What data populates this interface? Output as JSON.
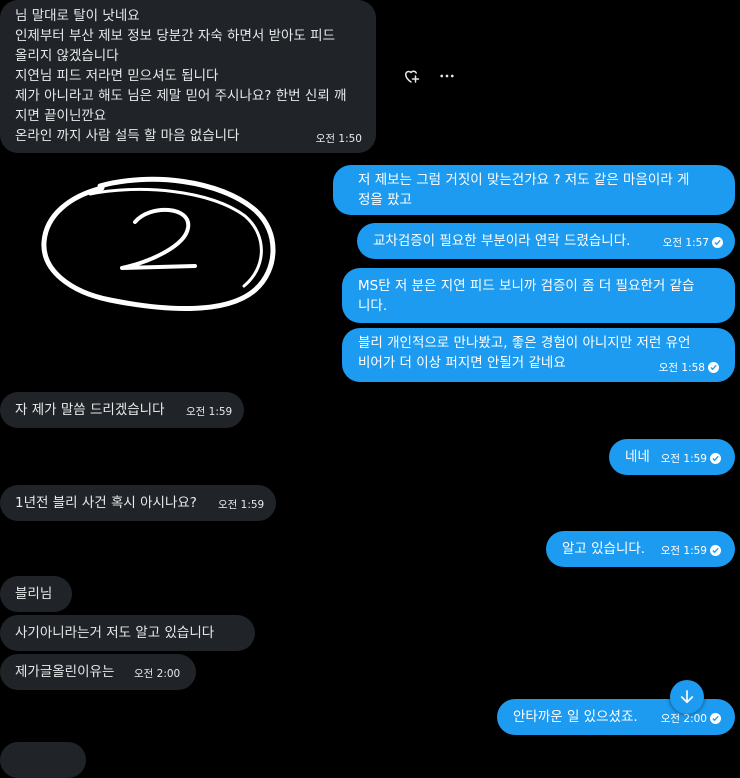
{
  "colors": {
    "background": "#000000",
    "incoming_bubble": "#202327",
    "outgoing_bubble": "#1d9bf0",
    "text": "#e7e9ea"
  },
  "message_actions": {
    "react_icon": "heart-plus-icon",
    "more_icon": "more-horizontal-icon"
  },
  "messages": [
    {
      "side": "in",
      "lines": [
        "님 말대로  탈이 낫네요",
        "인제부터 부산 제보  정보  당분간 자숙 하면서  받아도 피드",
        "올리지  않겠습니다",
        "지연님 피드 저라면 믿으셔도 됩니다",
        "제가 아니라고 해도 님은 제말 믿어 주시나요? 한번 신뢰 깨",
        "지면  끝이닌깐요",
        "온라인 까지  사람 설득 할 마음 없습니다"
      ],
      "time": "오전 1:50"
    },
    {
      "side": "image",
      "image_label": "2"
    },
    {
      "side": "out",
      "lines": [
        "저 제보는 그럼 거짓이 맞는건가요 ? 저도 같은 마음이라 게",
        "정을 팠고"
      ],
      "time": ""
    },
    {
      "side": "out",
      "lines": [
        "교차검증이 필요한 부분이라 연락 드렸습니다."
      ],
      "time": "오전 1:57"
    },
    {
      "side": "out",
      "lines": [
        "MS탄 저 분은 지연 피드 보니까 검증이 좀 더 필요한거 같습",
        "니다."
      ],
      "time": ""
    },
    {
      "side": "out",
      "lines": [
        "블리 개인적으로 만나봤고, 좋은 경험이 아니지만 저런 유언",
        "비어가 더 이상 퍼지면 안될거 같네요"
      ],
      "time": "오전 1:58"
    },
    {
      "side": "in",
      "lines": [
        "자 제가 말씀 드리겠습니다"
      ],
      "time": "오전 1:59"
    },
    {
      "side": "out",
      "lines": [
        "네네"
      ],
      "time": "오전 1:59"
    },
    {
      "side": "in",
      "lines": [
        "1년전 블리 사건 혹시 아시나요?"
      ],
      "time": "오전 1:59"
    },
    {
      "side": "out",
      "lines": [
        "알고 있습니다."
      ],
      "time": "오전 1:59"
    },
    {
      "side": "in",
      "lines": [
        "블리님"
      ],
      "time": ""
    },
    {
      "side": "in",
      "lines": [
        "사기아니라는거  저도  알고 있습니다"
      ],
      "time": ""
    },
    {
      "side": "in",
      "lines": [
        "제가글올린이유는"
      ],
      "time": "오전 2:00"
    },
    {
      "side": "out",
      "lines": [
        "안타까운 일 있으셨죠."
      ],
      "time": "오전 2:00"
    }
  ],
  "scroll_button_icon": "arrow-down-icon"
}
